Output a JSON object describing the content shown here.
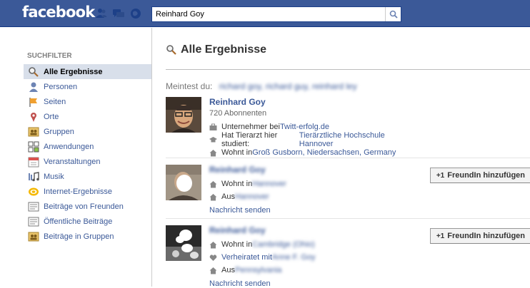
{
  "header": {
    "logo": "facebook",
    "search_value": "Reinhard Goy",
    "jewels": [
      "friend-requests-icon",
      "messages-icon",
      "notifications-globe-icon"
    ],
    "search_icon": "magnifier-icon"
  },
  "sidebar": {
    "title": "SUCHFILTER",
    "items": [
      {
        "label": "Alle Ergebnisse",
        "icon": "magnifier-icon"
      },
      {
        "label": "Personen",
        "icon": "person-icon"
      },
      {
        "label": "Seiten",
        "icon": "flag-icon"
      },
      {
        "label": "Orte",
        "icon": "map-pin-icon"
      },
      {
        "label": "Gruppen",
        "icon": "group-icon"
      },
      {
        "label": "Anwendungen",
        "icon": "apps-icon"
      },
      {
        "label": "Veranstaltungen",
        "icon": "calendar-icon"
      },
      {
        "label": "Musik",
        "icon": "music-icon"
      },
      {
        "label": "Internet-Ergebnisse",
        "icon": "web-results-icon"
      },
      {
        "label": "Beiträge von Freunden",
        "icon": "posts-icon"
      },
      {
        "label": "Öffentliche Beiträge",
        "icon": "posts-icon"
      },
      {
        "label": "Beiträge in Gruppen",
        "icon": "group-icon"
      }
    ]
  },
  "main": {
    "title": "Alle Ergebnisse",
    "suggest_label": "Meintest du:",
    "suggest_names": "richard goy, richard guy, reinhard ley",
    "results": [
      {
        "name": "Reinhard Goy",
        "subscribers": "720 Abonnenten",
        "work_prefix": "Unternehmer bei ",
        "work_link": "Twitt-erfolg.de",
        "study_prefix": "Hat Tierarzt hier studiert: ",
        "study_link": "Tierärztliche Hochschule Hannover",
        "lives_prefix": "Wohnt in ",
        "lives_link": "Groß Gusborn, Niedersachsen, Germany"
      },
      {
        "name": "Reinhard Goy",
        "lives_prefix": "Wohnt in ",
        "lives_link": "Hannover",
        "from_prefix": "Aus ",
        "from_link": "Hannover",
        "message": "Nachricht senden",
        "add_label": "FreundIn hinzufügen",
        "add_icon": "+1"
      },
      {
        "name": "Reinhard Goy",
        "lives_prefix": "Wohnt in ",
        "lives_link": "Cambridge (Ohio)",
        "married_prefix": "Verheiratet mit ",
        "married_link": "Anne F. Goy",
        "from_prefix": "Aus ",
        "from_link": "Pennsylvania",
        "message": "Nachricht senden",
        "add_label": "FreundIn hinzufügen",
        "add_icon": "+1"
      }
    ]
  },
  "colors": {
    "brand": "#3b5998",
    "active_filter_bg": "#d8dfea"
  }
}
